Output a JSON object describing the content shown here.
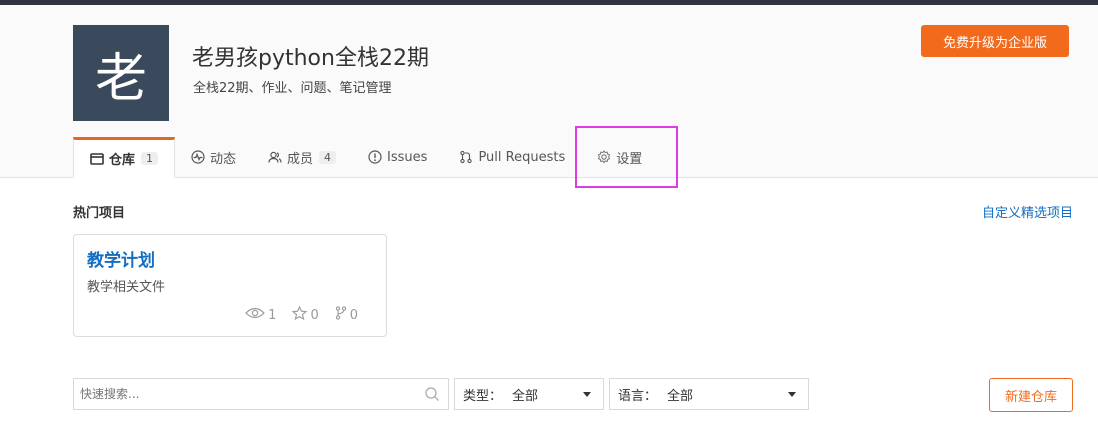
{
  "header": {
    "avatar_char": "老",
    "title": "老男孩python全栈22期",
    "description": "全栈22期、作业、问题、笔记管理",
    "upgrade_label": "免费升级为企业版"
  },
  "tabs": [
    {
      "label": "仓库",
      "badge": "1",
      "icon": "repo-icon"
    },
    {
      "label": "动态",
      "icon": "activity-icon"
    },
    {
      "label": "成员",
      "badge": "4",
      "icon": "members-icon"
    },
    {
      "label": "Issues",
      "icon": "issue-icon"
    },
    {
      "label": "Pull Requests",
      "icon": "pull-request-icon"
    },
    {
      "label": "设置",
      "icon": "gear-icon"
    }
  ],
  "featured": {
    "title": "热门项目",
    "custom_link": "自定义精选项目",
    "card": {
      "name": "教学计划",
      "desc": "教学相关文件",
      "watch": "1",
      "star": "0",
      "fork": "0"
    }
  },
  "filters": {
    "search_placeholder": "快速搜索...",
    "type_label": "类型：",
    "type_value": "全部",
    "lang_label": "语言：",
    "lang_value": "全部",
    "new_repo_label": "新建仓库"
  },
  "colors": {
    "accent": "#f26b1d",
    "link": "#136ec2",
    "highlight": "#e03be0",
    "avatar_bg": "#3a4a5c"
  }
}
